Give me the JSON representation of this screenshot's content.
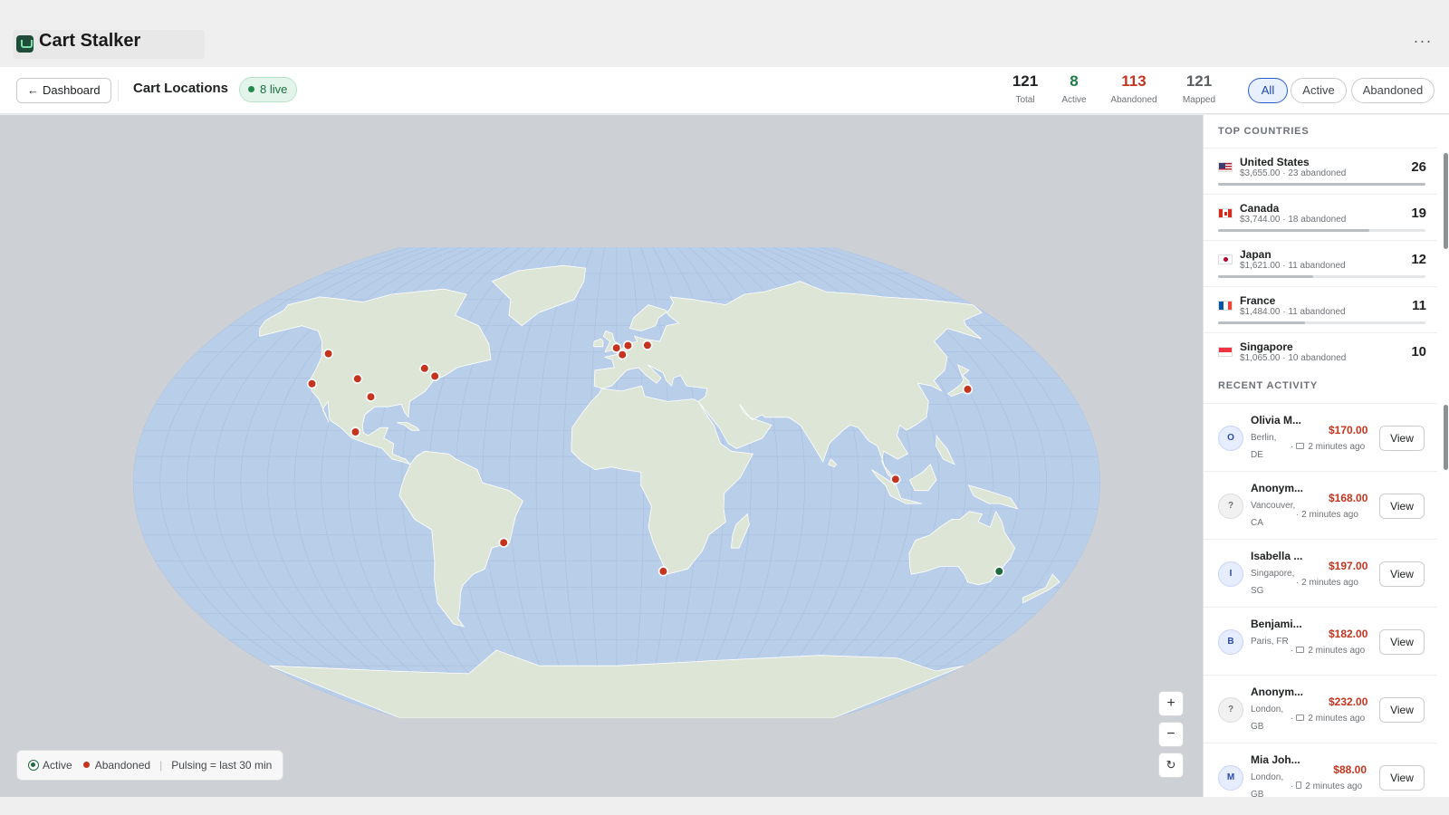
{
  "app": {
    "title": "Cart Stalker",
    "more_label": "···"
  },
  "toolbar": {
    "back_label": "Dashboard",
    "page_title": "Cart Locations",
    "live_badge": "8 live"
  },
  "stats": [
    {
      "value": "121",
      "label": "Total",
      "color": "#202223"
    },
    {
      "value": "8",
      "label": "Active",
      "color": "#1f7a45"
    },
    {
      "value": "113",
      "label": "Abandoned",
      "color": "#c4341f"
    },
    {
      "value": "121",
      "label": "Mapped",
      "color": "#5c5f62"
    }
  ],
  "filters": {
    "all": "All",
    "active": "Active",
    "abandoned": "Abandoned",
    "selected": "All"
  },
  "legend": {
    "active": "Active",
    "abandoned": "Abandoned",
    "pulsing": "Pulsing = last 30 min"
  },
  "zoom": {
    "in": "+",
    "out": "−",
    "reset": "↻"
  },
  "colors": {
    "active": "#1f6b3f",
    "abandoned": "#c4341f",
    "ocean": "#b9cee9",
    "land": "#dde5d7",
    "accent": "#2c5fd6"
  },
  "map_markers": [
    {
      "place": "Vancouver",
      "status": "abandoned",
      "lat": 49.3,
      "lon": -123.1
    },
    {
      "place": "San Francisco",
      "status": "abandoned",
      "lat": 37.8,
      "lon": -122.4
    },
    {
      "place": "Denver",
      "status": "abandoned",
      "lat": 39.7,
      "lon": -105.0
    },
    {
      "place": "Dallas",
      "status": "abandoned",
      "lat": 32.8,
      "lon": -96.8
    },
    {
      "place": "Toronto",
      "status": "abandoned",
      "lat": 43.7,
      "lon": -79.4
    },
    {
      "place": "New York",
      "status": "abandoned",
      "lat": 40.7,
      "lon": -74.0
    },
    {
      "place": "Mexico City",
      "status": "abandoned",
      "lat": 19.4,
      "lon": -99.1
    },
    {
      "place": "London",
      "status": "abandoned",
      "lat": 51.5,
      "lon": -0.1
    },
    {
      "place": "Amsterdam",
      "status": "abandoned",
      "lat": 52.4,
      "lon": 4.9
    },
    {
      "place": "Paris",
      "status": "abandoned",
      "lat": 48.9,
      "lon": 2.4
    },
    {
      "place": "Berlin",
      "status": "abandoned",
      "lat": 52.5,
      "lon": 13.4
    },
    {
      "place": "Tokyo",
      "status": "abandoned",
      "lat": 35.7,
      "lon": 139.7
    },
    {
      "place": "Singapore",
      "status": "abandoned",
      "lat": 1.3,
      "lon": 103.8
    },
    {
      "place": "Rio de Janeiro",
      "status": "abandoned",
      "lat": -22.9,
      "lon": -43.2
    },
    {
      "place": "Cape Town",
      "status": "abandoned",
      "lat": -33.9,
      "lon": 18.4
    },
    {
      "place": "Sydney",
      "status": "active",
      "lat": -33.9,
      "lon": 151.2
    }
  ],
  "sidebar": {
    "top_countries_title": "TOP COUNTRIES",
    "recent_activity_title": "RECENT ACTIVITY",
    "countries": [
      {
        "name": "United States",
        "sub": "$3,655.00 · 23 abandoned",
        "count": "26",
        "share": 1.0,
        "flag": "us"
      },
      {
        "name": "Canada",
        "sub": "$3,744.00 · 18 abandoned",
        "count": "19",
        "share": 0.73,
        "flag": "ca"
      },
      {
        "name": "Japan",
        "sub": "$1,621.00 · 11 abandoned",
        "count": "12",
        "share": 0.46,
        "flag": "jp"
      },
      {
        "name": "France",
        "sub": "$1,484.00 · 11 abandoned",
        "count": "11",
        "share": 0.42,
        "flag": "fr"
      },
      {
        "name": "Singapore",
        "sub": "$1,065.00 · 10 abandoned",
        "count": "10",
        "share": 0.38,
        "flag": "sg"
      }
    ],
    "activity": [
      {
        "initial": "O",
        "name": "Olivia M...",
        "loc": "Berlin, DE",
        "device": "desktop-icon",
        "time": "2 minutes ago",
        "amount": "$170.00",
        "view": "View",
        "anon": false
      },
      {
        "initial": "?",
        "name": "Anonym...",
        "loc": "Vancouver, CA",
        "device": "",
        "time": "2 minutes ago",
        "amount": "$168.00",
        "view": "View",
        "anon": true
      },
      {
        "initial": "I",
        "name": "Isabella ...",
        "loc": "Singapore, SG",
        "device": "",
        "time": "2 minutes ago",
        "amount": "$197.00",
        "view": "View",
        "anon": false
      },
      {
        "initial": "B",
        "name": "Benjami...",
        "loc": "Paris, FR",
        "device": "desktop-icon",
        "time": "2 minutes ago",
        "amount": "$182.00",
        "view": "View",
        "anon": false
      },
      {
        "initial": "?",
        "name": "Anonym...",
        "loc": "London, GB",
        "device": "desktop-icon",
        "time": "2 minutes ago",
        "amount": "$232.00",
        "view": "View",
        "anon": true
      },
      {
        "initial": "M",
        "name": "Mia Joh...",
        "loc": "London, GB",
        "device": "phone-icon",
        "time": "2 minutes ago",
        "amount": "$88.00",
        "view": "View",
        "anon": false
      }
    ]
  }
}
